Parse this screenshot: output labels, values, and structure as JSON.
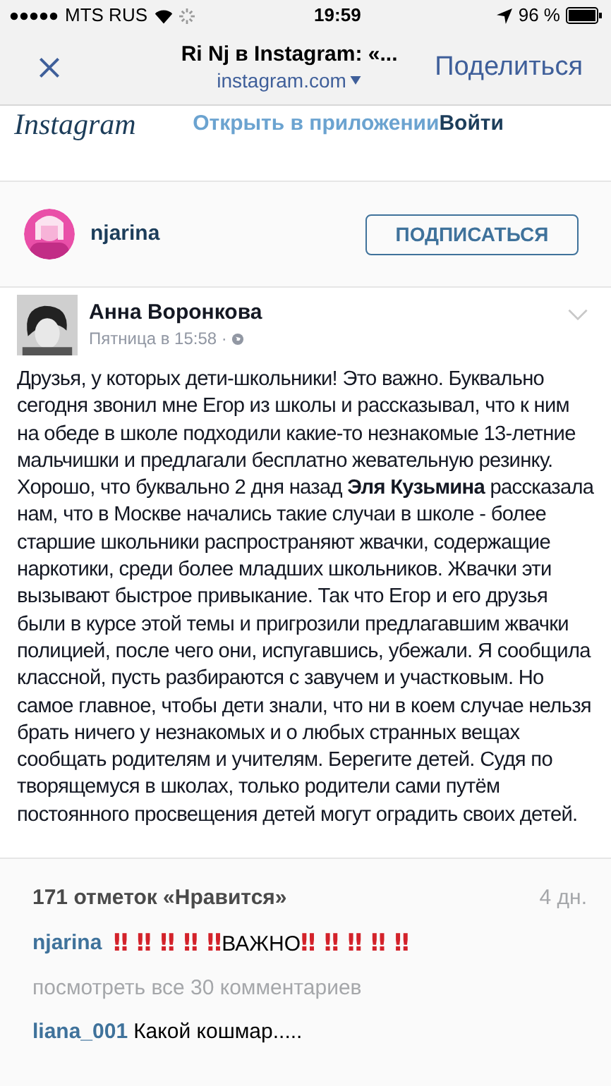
{
  "status_bar": {
    "carrier": "MTS RUS",
    "time": "19:59",
    "battery": "96 %"
  },
  "nav_bar": {
    "title": "Ri Nj в Instagram: «...",
    "url": "instagram.com",
    "share": "Поделиться"
  },
  "site_header": {
    "logo": "Instagram",
    "open_in_app": "Открыть в приложении",
    "login": "Войти"
  },
  "profile": {
    "username": "njarina",
    "follow": "ПОДПИСАТЬСЯ"
  },
  "post": {
    "author": "Анна Воронкова",
    "date": "Пятница в 15:58 ·",
    "text": "Друзья, у которых дети-школьники! Это важно. Буквально сегодня звонил мне Егор из школы и рассказывал, что к ним на обеде в школе подходили какие-то незнакомые 13-летние мальчишки и предлагали бесплатно жевательную резинку. Хорошо, что буквально 2 дня назад **Эля Кузьмина** рассказала нам, что в Москве начались такие случаи в школе - более старшие школьники распространяют жвачки, содержащие наркотики, среди более младших школьников. Жвачки эти вызывают быстрое привыкание. Так что Егор и его друзья были в курсе этой темы и пригрозили предлагавшим жвачки полицией, после чего они, испугавшись, убежали. Я сообщила классной, пусть разбираются с завучем и участковым. Но самое главное, чтобы дети знали, что ни в коем случае нельзя брать ничего у незнакомых и о любых странных вещах сообщать родителям и учителям. Берегите детей. Судя по творящемуся в школах, только родители сами путём постоянного просвещения детей могут оградить своих детей."
  },
  "likes": {
    "count": "171 отметок «Нравится»",
    "age": "4 дн."
  },
  "caption": {
    "username": "njarina",
    "parts": [
      {
        "kind": "emoji",
        "text": "‼ ‼ ‼ ‼ ‼"
      },
      {
        "kind": "plain",
        "text": "ВАЖНО"
      },
      {
        "kind": "emoji",
        "text": "‼ ‼ ‼ ‼ ‼"
      }
    ]
  },
  "view_all": "посмотреть все 30 комментариев",
  "comments": [
    {
      "username": "liana_001",
      "text": "Какой кошмар....."
    }
  ]
}
